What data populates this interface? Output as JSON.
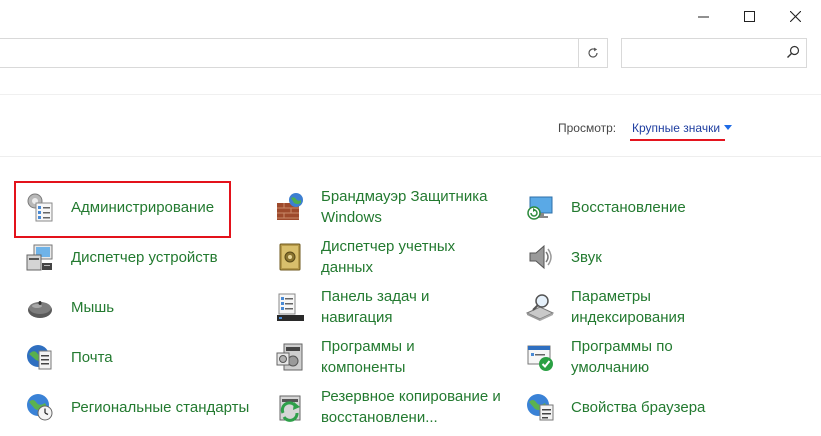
{
  "window": {
    "buttons": [
      "minimize",
      "maximize",
      "close"
    ]
  },
  "search": {
    "placeholder": ""
  },
  "view": {
    "label": "Просмотр:",
    "value": "Крупные значки"
  },
  "items": [
    {
      "label": "Администрирование",
      "icon": "administrative-tools-icon"
    },
    {
      "label": "Брандмауэр Защитника\nWindows",
      "icon": "firewall-icon"
    },
    {
      "label": "Восстановление",
      "icon": "recovery-icon"
    },
    {
      "label": "Диспетчер устройств",
      "icon": "device-manager-icon"
    },
    {
      "label": "Диспетчер учетных\nданных",
      "icon": "credential-manager-icon"
    },
    {
      "label": "Звук",
      "icon": "sound-icon"
    },
    {
      "label": "Мышь",
      "icon": "mouse-icon"
    },
    {
      "label": "Панель задач и\nнавигация",
      "icon": "taskbar-icon"
    },
    {
      "label": "Параметры\nиндексирования",
      "icon": "indexing-icon"
    },
    {
      "label": "Почта",
      "icon": "mail-icon"
    },
    {
      "label": "Программы и\nкомпоненты",
      "icon": "programs-icon"
    },
    {
      "label": "Программы по\nумолчанию",
      "icon": "default-programs-icon"
    },
    {
      "label": "Региональные стандарты",
      "icon": "region-icon"
    },
    {
      "label": "Резервное копирование и\nвосстановлени...",
      "icon": "backup-icon"
    },
    {
      "label": "Свойства браузера",
      "icon": "internet-options-icon"
    }
  ],
  "colors": {
    "link_green": "#237a30",
    "link_blue": "#1f3ea0",
    "highlight_red": "#e3121b"
  }
}
